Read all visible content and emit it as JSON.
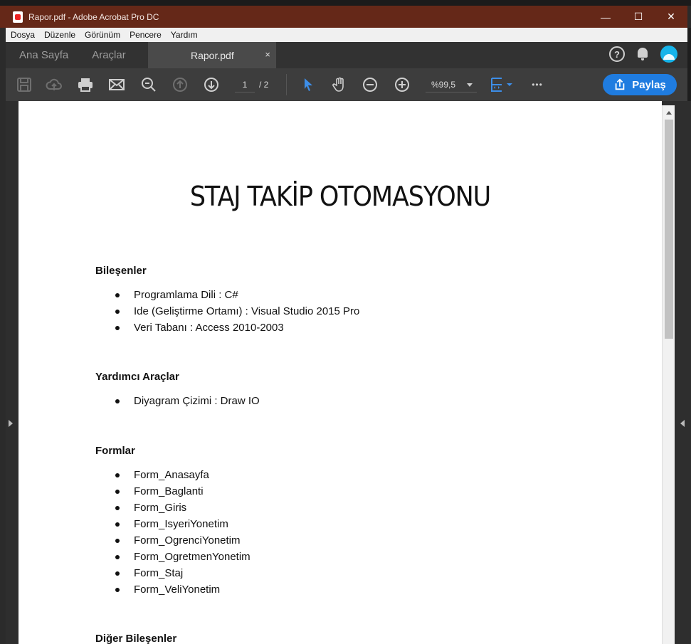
{
  "window": {
    "title": "Rapor.pdf - Adobe Acrobat Pro DC",
    "controls": [
      "—",
      "☐",
      "✕"
    ]
  },
  "menu": [
    "Dosya",
    "Düzenle",
    "Görünüm",
    "Pencere",
    "Yardım"
  ],
  "tabs": {
    "home": "Ana Sayfa",
    "tools": "Araçlar",
    "document": "Rapor.pdf",
    "close": "×",
    "help": "?"
  },
  "toolbar": {
    "current_page": "1",
    "page_total": "/  2",
    "zoom": "%99,5",
    "share_label": "Paylaş",
    "more": "•••"
  },
  "document": {
    "title": "STAJ TAKİP OTOMASYONU",
    "sections": [
      {
        "heading": "Bileşenler",
        "items": [
          "Programlama Dili : C#",
          "Ide (Geliştirme Ortamı) : Visual Studio 2015 Pro",
          "Veri Tabanı : Access 2010-2003"
        ]
      },
      {
        "heading": "Yardımcı Araçlar",
        "items": [
          "Diyagram Çizimi : Draw IO"
        ]
      },
      {
        "heading": "Formlar",
        "items": [
          "Form_Anasayfa",
          "Form_Baglanti",
          "Form_Giris",
          "Form_IsyeriYonetim",
          "Form_OgrenciYonetim",
          "Form_OgretmenYonetim",
          "Form_Staj",
          "Form_VeliYonetim"
        ]
      },
      {
        "heading": "Diğer Bileşenler",
        "items": []
      }
    ]
  },
  "colors": {
    "titlebar": "#652818",
    "share_button": "#1f7ce0",
    "select_tool": "#3d8ee8"
  }
}
